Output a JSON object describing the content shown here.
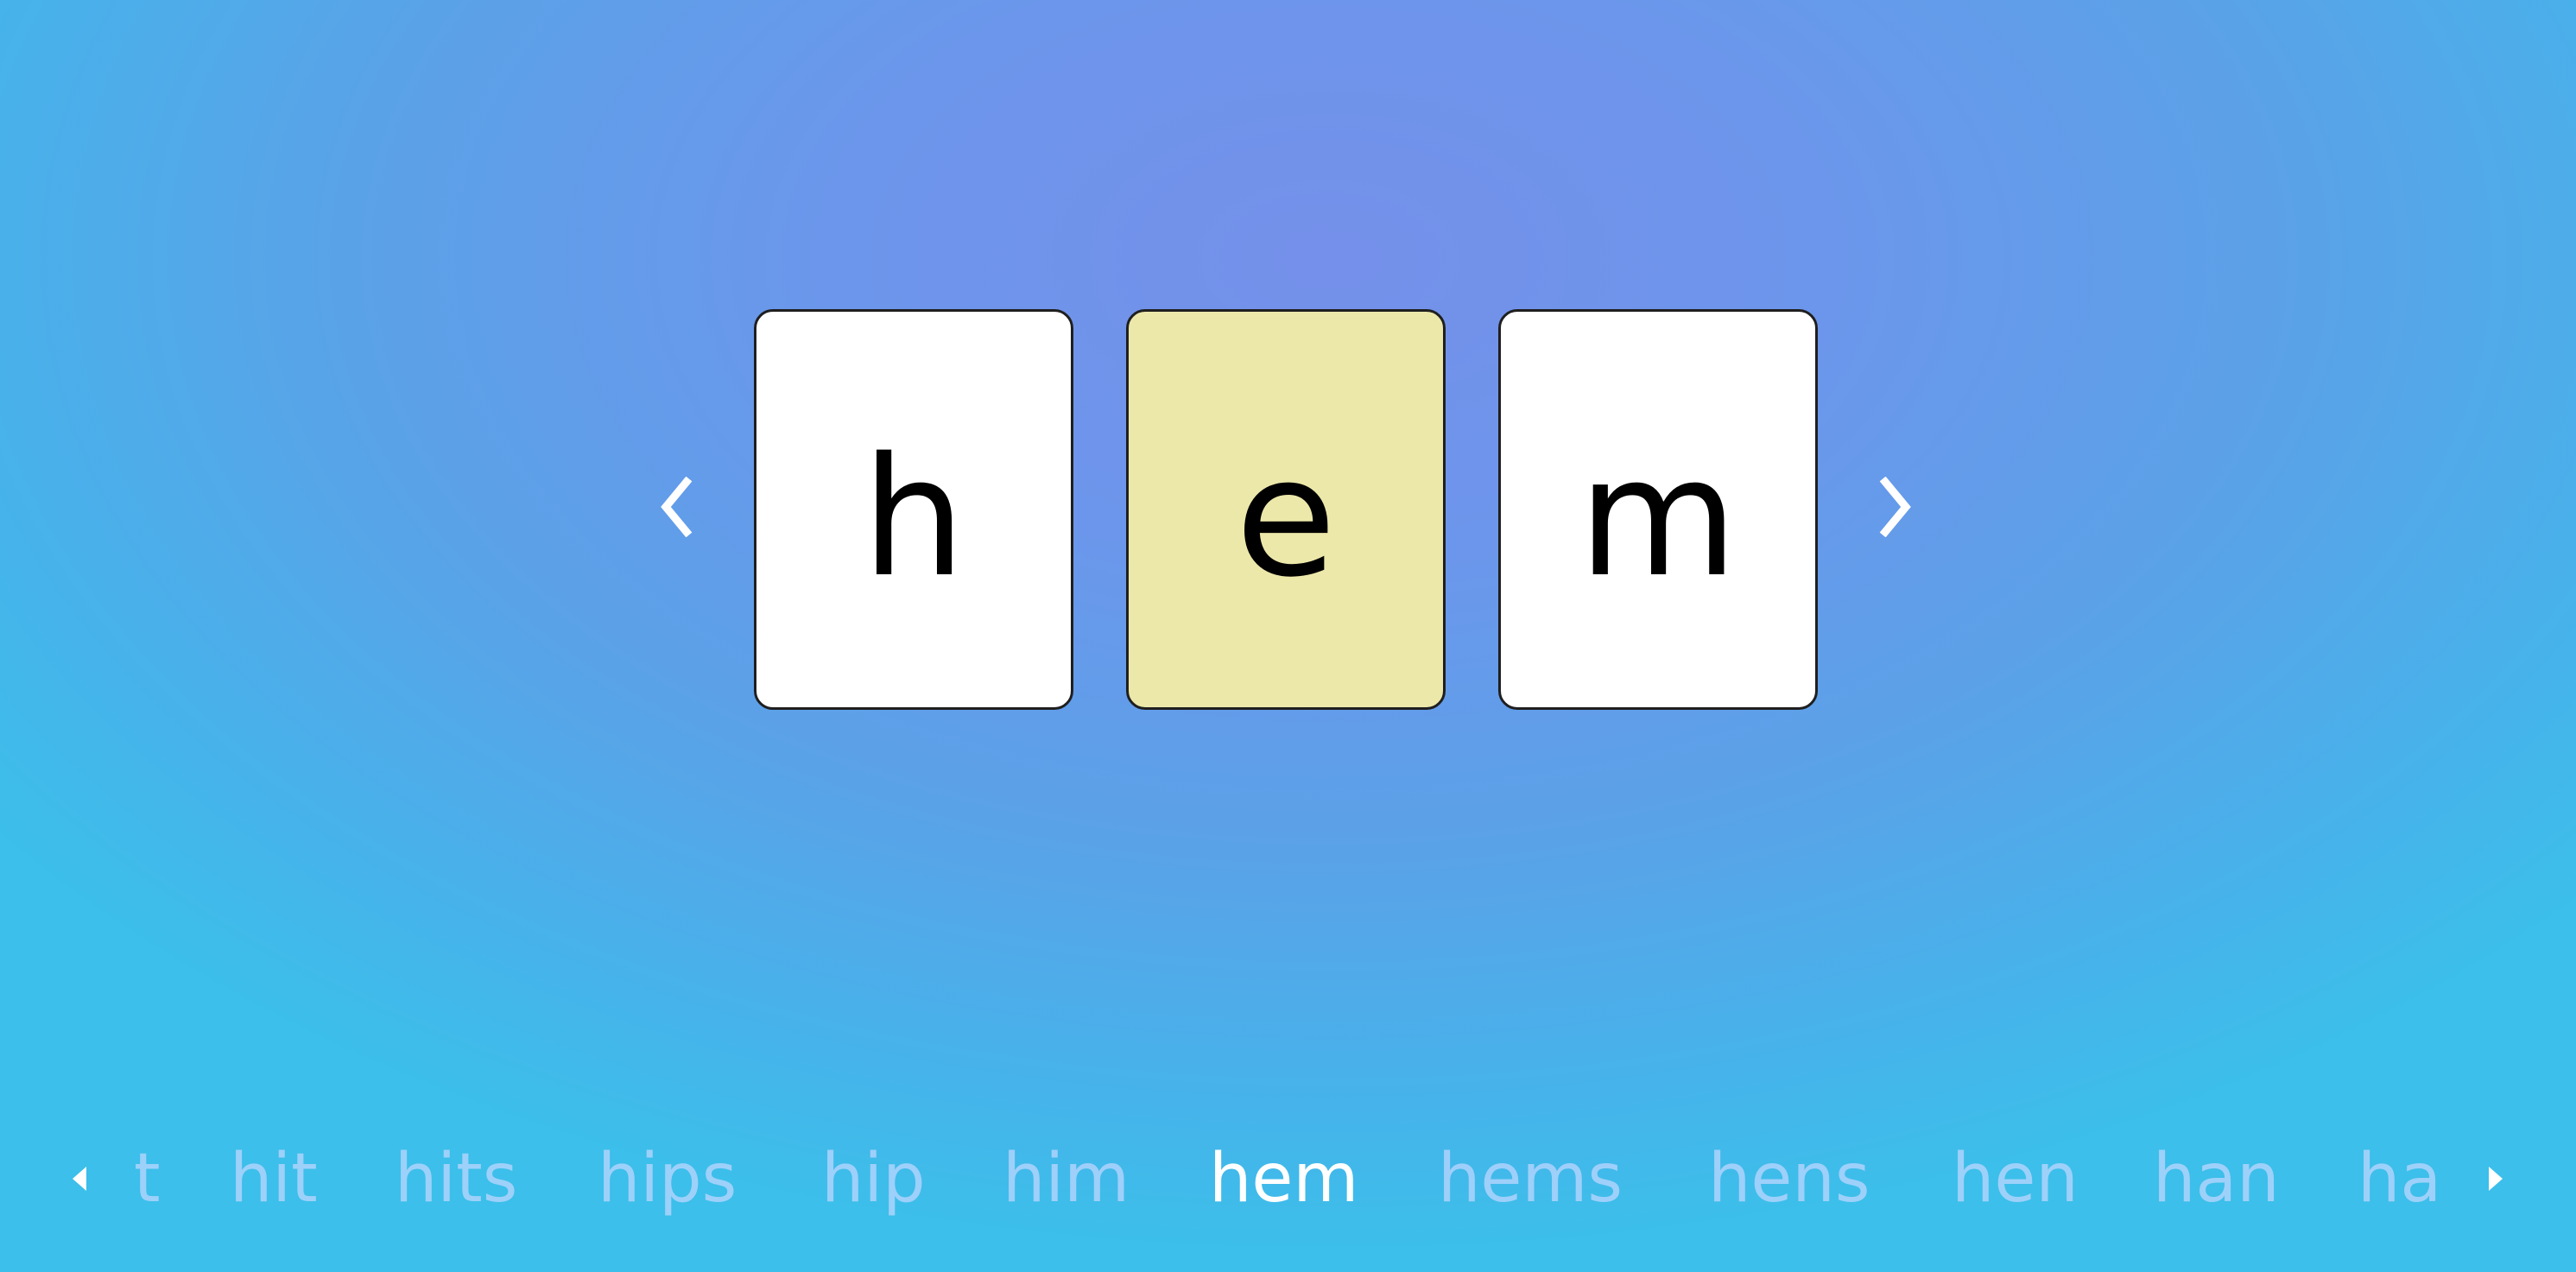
{
  "letters": [
    {
      "char": "h",
      "selected": false
    },
    {
      "char": "e",
      "selected": true
    },
    {
      "char": "m",
      "selected": false
    }
  ],
  "word_history": [
    "t",
    "hit",
    "hits",
    "hips",
    "hip",
    "him",
    "hem",
    "hems",
    "hens",
    "hen",
    "han",
    "ha"
  ],
  "current_word": "hem",
  "colors": {
    "tile_default": "#ffffff",
    "tile_selected": "#ece8aa",
    "word_current": "#ffffff",
    "word_inactive": "#bed7ff"
  },
  "icons": {
    "prev_letter": "chevron-left-icon",
    "next_letter": "chevron-right-icon",
    "history_prev": "triangle-left-icon",
    "history_next": "triangle-right-icon"
  }
}
